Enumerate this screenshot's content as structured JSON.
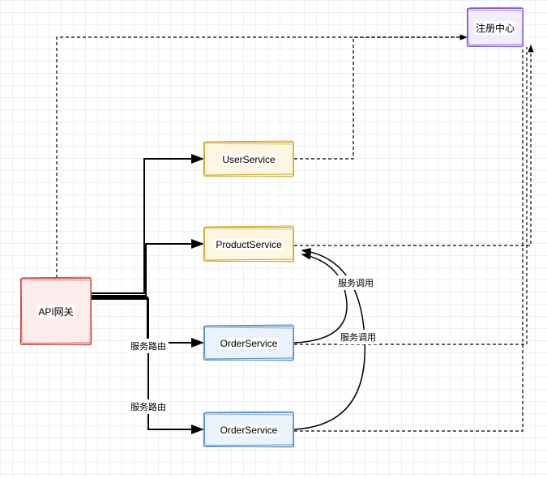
{
  "nodes": {
    "api_gateway": {
      "label": "API网关"
    },
    "user_service": {
      "label": "UserService"
    },
    "product_service": {
      "label": "ProductService"
    },
    "order_service_1": {
      "label": "OrderService"
    },
    "order_service_2": {
      "label": "OrderService"
    },
    "registry": {
      "label": "注册中心"
    }
  },
  "edge_labels": {
    "route_1": "服务路由",
    "route_2": "服务路由",
    "call_1": "服务调用",
    "call_2": "服务调用"
  }
}
